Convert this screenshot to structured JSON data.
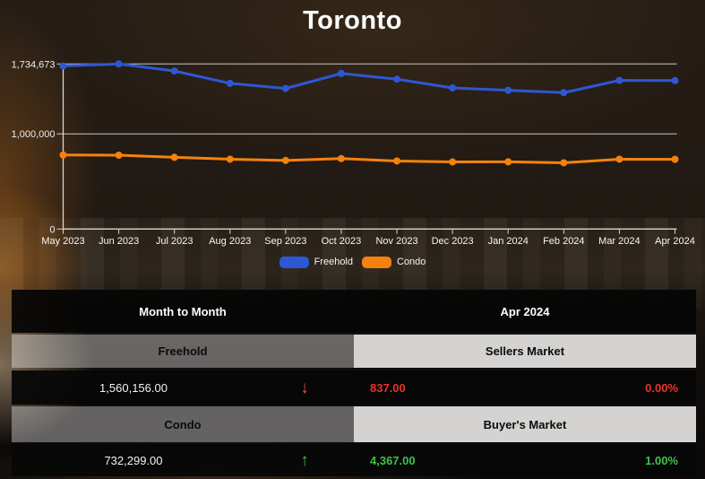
{
  "title": "Toronto",
  "colors": {
    "freehold_blue": "#2e57d4",
    "condo_orange": "#f5820d",
    "negative_red": "#e8332a",
    "positive_green": "#3ec24b",
    "grid_line": "#cccccc",
    "axis_line": "#d6d6d6"
  },
  "chart_data": {
    "type": "line",
    "x": [
      "May 2023",
      "Jun 2023",
      "Jul 2023",
      "Aug 2023",
      "Sep 2023",
      "Oct 2023",
      "Nov 2023",
      "Dec 2023",
      "Jan 2024",
      "Feb 2024",
      "Mar 2024",
      "Apr 2024"
    ],
    "series": [
      {
        "name": "Freehold",
        "color": "#2e57d4",
        "values": [
          1714000,
          1734673,
          1661000,
          1531000,
          1477000,
          1635000,
          1575000,
          1483000,
          1458000,
          1433000,
          1562000,
          1560156
        ]
      },
      {
        "name": "Condo",
        "color": "#f5820d",
        "values": [
          778000,
          776000,
          753000,
          734000,
          721000,
          740000,
          715000,
          705000,
          706000,
          696000,
          734000,
          732299
        ]
      }
    ],
    "title": "Toronto",
    "xlabel": "",
    "ylabel": "",
    "ylim": [
      0,
      1734673
    ],
    "yticks": [
      {
        "label": "1,734,673",
        "value": 1734673
      },
      {
        "label": "1,000,000",
        "value": 1000000
      },
      {
        "label": "0",
        "value": 0
      }
    ],
    "grid": "horizontal",
    "legend_position": "bottom"
  },
  "legend": [
    {
      "label": "Freehold",
      "color": "#2e57d4"
    },
    {
      "label": "Condo",
      "color": "#f5820d"
    }
  ],
  "table": {
    "header": {
      "left": "Month to Month",
      "right": "Apr 2024"
    },
    "rows": [
      {
        "band_left": "Freehold",
        "band_right": "Sellers Market",
        "value": "1,560,156.00",
        "arrow": "↓",
        "trend": "down",
        "metric": "837.00",
        "percent": "0.00%"
      },
      {
        "band_left": "Condo",
        "band_right": "Buyer's Market",
        "value": "732,299.00",
        "arrow": "↑",
        "trend": "up",
        "metric": "4,367.00",
        "percent": "1.00%"
      }
    ]
  }
}
